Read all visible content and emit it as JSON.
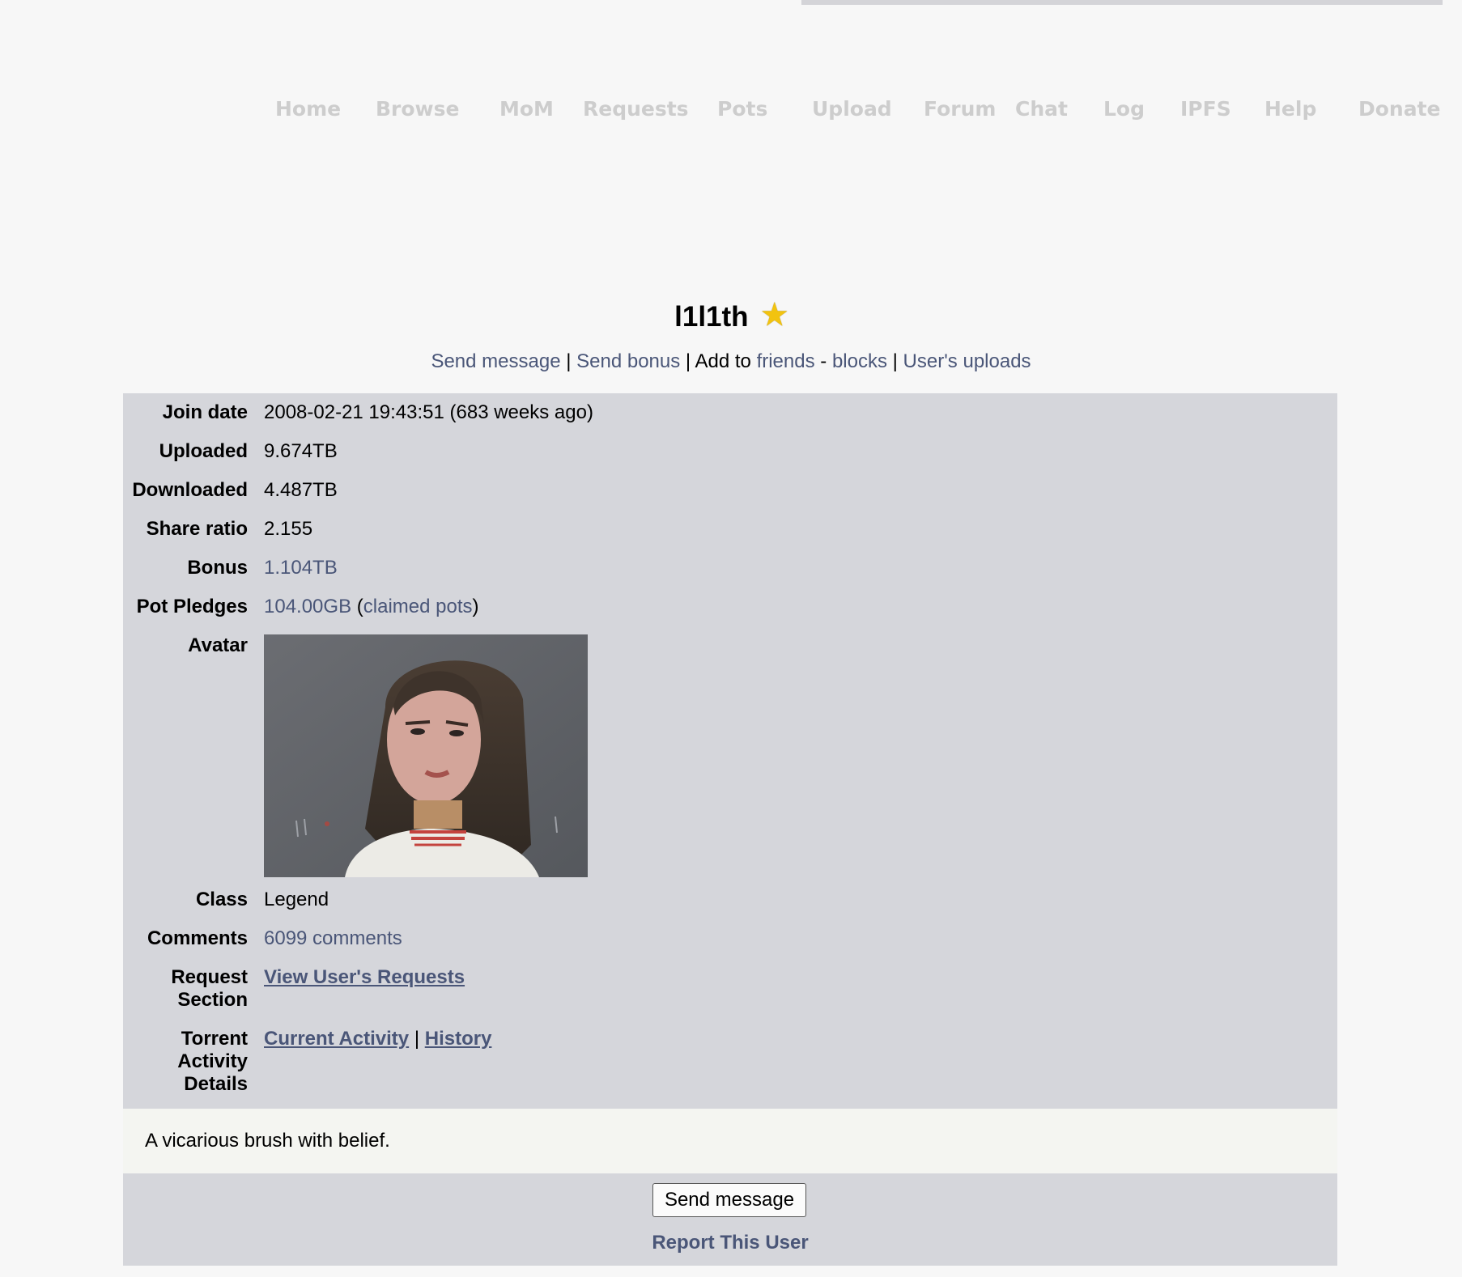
{
  "nav": {
    "items": [
      "Home",
      "Browse",
      "MoM",
      "Requests",
      "Pots",
      "Upload",
      "Forum",
      "Chat",
      "Log",
      "IPFS",
      "Help",
      "Donate"
    ]
  },
  "profile": {
    "username": "l1l1th",
    "badge_icon": "star-icon"
  },
  "actions": {
    "send_message": "Send message",
    "sep1": " | ",
    "send_bonus": "Send bonus",
    "sep2": " | Add to ",
    "friends": "friends",
    "sep3": " - ",
    "blocks": "blocks",
    "sep4": " | ",
    "uploads": "User's uploads"
  },
  "stats": {
    "join_date_label": "Join date",
    "join_date": "2008-02-21 19:43:51 (683 weeks ago)",
    "uploaded_label": "Uploaded",
    "uploaded": "9.674TB",
    "downloaded_label": "Downloaded",
    "downloaded": "4.487TB",
    "ratio_label": "Share ratio",
    "ratio": "2.155",
    "bonus_label": "Bonus",
    "bonus": "1.104TB",
    "pledges_label": "Pot Pledges",
    "pledges": "104.00GB",
    "pledges_open": " (",
    "claimed_pots": "claimed pots",
    "pledges_close": ")",
    "avatar_label": "Avatar",
    "class_label": "Class",
    "class": "Legend",
    "comments_label": "Comments",
    "comments": "6099 comments",
    "requests_label_1": "Request",
    "requests_label_2": "Section",
    "requests_link": "View User's Requests",
    "activity_label_1": "Torrent",
    "activity_label_2": "Activity",
    "activity_label_3": "Details",
    "current_activity": "Current Activity",
    "activity_sep": " | ",
    "history": "History"
  },
  "bio": "A vicarious brush with belief.",
  "footer": {
    "send_button": "Send message",
    "report": "Report This User"
  },
  "colors": {
    "link": "#4a5678",
    "panel": "#d5d6db",
    "nav_text": "#cdcdcd",
    "star": "#f2c30f"
  }
}
